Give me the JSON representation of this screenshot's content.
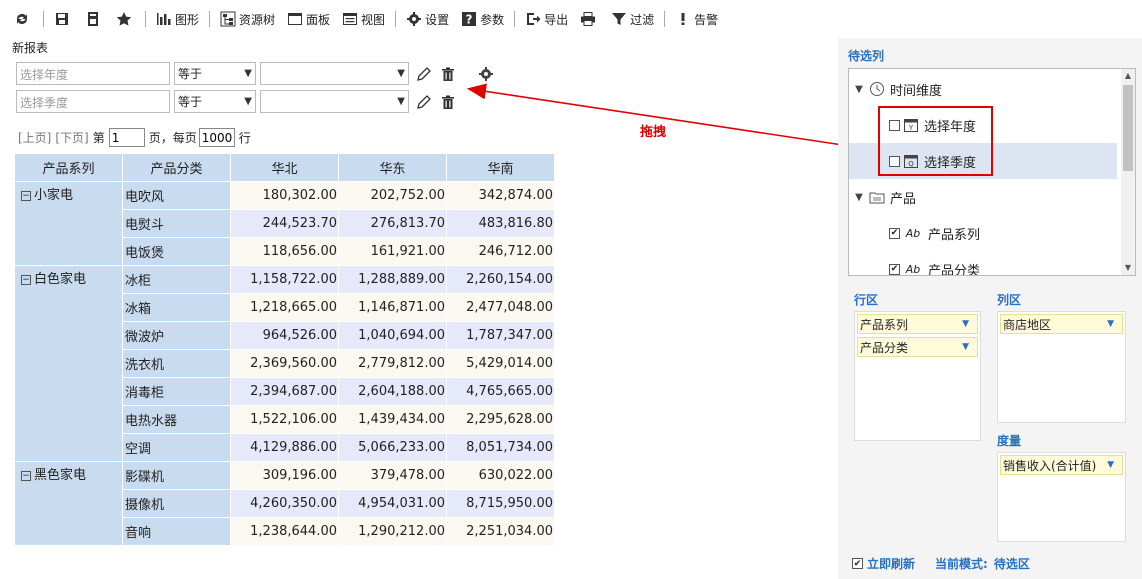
{
  "toolbar": {
    "chart": "图形",
    "resource_tree": "资源树",
    "panel": "面板",
    "view": "视图",
    "settings": "设置",
    "params": "参数",
    "export": "导出",
    "filter": "过滤",
    "alert": "告警"
  },
  "report_title": "新报表",
  "filters": [
    {
      "field_placeholder": "选择年度",
      "operator": "等于",
      "value": ""
    },
    {
      "field_placeholder": "选择季度",
      "operator": "等于",
      "value": ""
    }
  ],
  "pager": {
    "prev": "[上页]",
    "next": "[下页]",
    "page_prefix": "第",
    "page": "1",
    "page_suffix": "页，每页",
    "per_page": "1000",
    "rows_suffix": "行"
  },
  "table": {
    "headers": [
      "产品系列",
      "产品分类",
      "华北",
      "华东",
      "华南"
    ],
    "groups": [
      {
        "name": "小家电",
        "rows": [
          {
            "cat": "电吹风",
            "v": [
              "180,302.00",
              "202,752.00",
              "342,874.00"
            ]
          },
          {
            "cat": "电熨斗",
            "v": [
              "244,523.70",
              "276,813.70",
              "483,816.80"
            ]
          },
          {
            "cat": "电饭煲",
            "v": [
              "118,656.00",
              "161,921.00",
              "246,712.00"
            ]
          }
        ]
      },
      {
        "name": "白色家电",
        "rows": [
          {
            "cat": "冰柜",
            "v": [
              "1,158,722.00",
              "1,288,889.00",
              "2,260,154.00"
            ]
          },
          {
            "cat": "冰箱",
            "v": [
              "1,218,665.00",
              "1,146,871.00",
              "2,477,048.00"
            ]
          },
          {
            "cat": "微波炉",
            "v": [
              "964,526.00",
              "1,040,694.00",
              "1,787,347.00"
            ]
          },
          {
            "cat": "洗衣机",
            "v": [
              "2,369,560.00",
              "2,779,812.00",
              "5,429,014.00"
            ]
          },
          {
            "cat": "消毒柜",
            "v": [
              "2,394,687.00",
              "2,604,188.00",
              "4,765,665.00"
            ]
          },
          {
            "cat": "电热水器",
            "v": [
              "1,522,106.00",
              "1,439,434.00",
              "2,295,628.00"
            ]
          },
          {
            "cat": "空调",
            "v": [
              "4,129,886.00",
              "5,066,233.00",
              "8,051,734.00"
            ]
          }
        ]
      },
      {
        "name": "黑色家电",
        "rows": [
          {
            "cat": "影碟机",
            "v": [
              "309,196.00",
              "379,478.00",
              "630,022.00"
            ]
          },
          {
            "cat": "摄像机",
            "v": [
              "4,260,350.00",
              "4,954,031.00",
              "8,715,950.00"
            ]
          },
          {
            "cat": "音响",
            "v": [
              "1,238,644.00",
              "1,290,212.00",
              "2,251,034.00"
            ]
          }
        ]
      }
    ]
  },
  "annotation": {
    "drag_label": "拖拽",
    "color": "#e00000"
  },
  "right_panel": {
    "title": "待选列",
    "tree": [
      {
        "label": "时间维度",
        "type": "folder"
      },
      {
        "label": "选择年度",
        "type": "param",
        "checked": false
      },
      {
        "label": "选择季度",
        "type": "param",
        "checked": false
      },
      {
        "label": "产品",
        "type": "folder"
      },
      {
        "label": "产品系列",
        "type": "field",
        "checked": true
      },
      {
        "label": "产品分类",
        "type": "field",
        "checked": true
      }
    ],
    "row_zone_title": "行区",
    "row_zone": [
      "产品系列",
      "产品分类"
    ],
    "col_zone_title": "列区",
    "col_zone": [
      "商店地区"
    ],
    "measure_title": "度量",
    "measure_zone": [
      "销售收入(合计值)"
    ],
    "auto_refresh": "立即刷新",
    "mode_label": "当前模式:",
    "mode_value": "待选区"
  },
  "colors": {
    "accent": "#2b6fc0",
    "header_bg": "#c8dbef",
    "alt_row": "#e6e9fa",
    "chip_bg": "#fffbd9"
  }
}
